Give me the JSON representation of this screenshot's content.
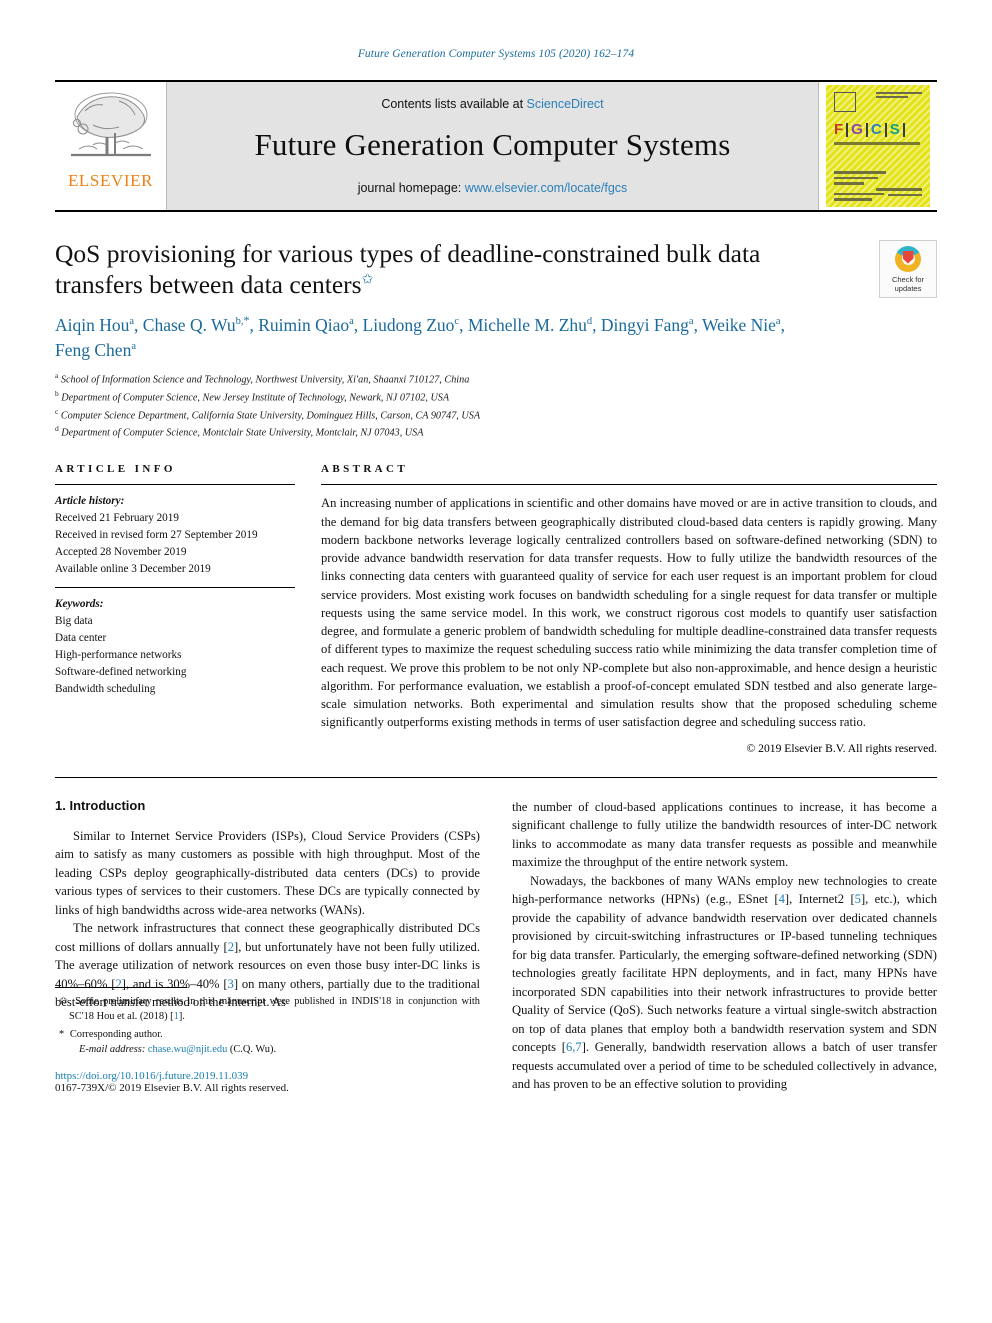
{
  "running_head": "Future Generation Computer Systems 105 (2020) 162–174",
  "masthead": {
    "contents_prefix": "Contents lists available at ",
    "contents_link": "ScienceDirect",
    "journal_title": "Future Generation Computer Systems",
    "homepage_prefix": "journal homepage: ",
    "homepage_link": "www.elsevier.com/locate/fgcs",
    "publisher_name": "ELSEVIER",
    "cover_letters": [
      "F",
      "G",
      "C",
      "S"
    ],
    "cover_letter_colors": [
      "#c0392b",
      "#8e44ad",
      "#2980b9",
      "#16a085"
    ],
    "link_color": "#2a7fb8"
  },
  "article": {
    "title": "QoS provisioning for various types of deadline-constrained bulk data transfers between data centers",
    "title_footnote_marker": "✩",
    "crossmark_label_line1": "Check for",
    "crossmark_label_line2": "updates",
    "authors_html": "Aiqin Hou<sup>a</sup>, Chase Q. Wu<sup>b,<span class=\"star\">*</span></sup>, Ruimin Qiao<sup>a</sup>, Liudong Zuo<sup>c</sup>, Michelle M. Zhu<sup>d</sup>, Dingyi Fang<sup>a</sup>, Weike Nie<sup>a</sup>, Feng Chen<sup>a</sup>",
    "affiliations": [
      {
        "marker": "a",
        "text": "School of Information Science and Technology, Northwest University, Xi'an, Shaanxi 710127, China"
      },
      {
        "marker": "b",
        "text": "Department of Computer Science, New Jersey Institute of Technology, Newark, NJ 07102, USA"
      },
      {
        "marker": "c",
        "text": "Computer Science Department, California State University, Dominguez Hills, Carson, CA 90747, USA"
      },
      {
        "marker": "d",
        "text": "Department of Computer Science, Montclair State University, Montclair, NJ 07043, USA"
      }
    ]
  },
  "article_info": {
    "label": "ARTICLE INFO",
    "history_label": "Article history:",
    "history": [
      "Received 21 February 2019",
      "Received in revised form 27 September 2019",
      "Accepted 28 November 2019",
      "Available online 3 December 2019"
    ],
    "keywords_label": "Keywords:",
    "keywords": [
      "Big data",
      "Data center",
      "High-performance networks",
      "Software-defined networking",
      "Bandwidth scheduling"
    ]
  },
  "abstract": {
    "label": "ABSTRACT",
    "text": "An increasing number of applications in scientific and other domains have moved or are in active transition to clouds, and the demand for big data transfers between geographically distributed cloud-based data centers is rapidly growing. Many modern backbone networks leverage logically centralized controllers based on software-defined networking (SDN) to provide advance bandwidth reservation for data transfer requests. How to fully utilize the bandwidth resources of the links connecting data centers with guaranteed quality of service for each user request is an important problem for cloud service providers. Most existing work focuses on bandwidth scheduling for a single request for data transfer or multiple requests using the same service model. In this work, we construct rigorous cost models to quantify user satisfaction degree, and formulate a generic problem of bandwidth scheduling for multiple deadline-constrained data transfer requests of different types to maximize the request scheduling success ratio while minimizing the data transfer completion time of each request. We prove this problem to be not only NP-complete but also non-approximable, and hence design a heuristic algorithm. For performance evaluation, we establish a proof-of-concept emulated SDN testbed and also generate large-scale simulation networks. Both experimental and simulation results show that the proposed scheduling scheme significantly outperforms existing methods in terms of user satisfaction degree and scheduling success ratio.",
    "copyright": "© 2019 Elsevier B.V. All rights reserved."
  },
  "introduction": {
    "heading": "1. Introduction",
    "left_paragraphs": [
      "Similar to Internet Service Providers (ISPs), Cloud Service Providers (CSPs) aim to satisfy as many customers as possible with high throughput. Most of the leading CSPs deploy geographically-distributed data centers (DCs) to provide various types of services to their customers. These DCs are typically connected by links of high bandwidths across wide-area networks (WANs)."
    ],
    "left_para2_parts": [
      "The network infrastructures that connect these geographically distributed DCs cost millions of dollars annually [",
      "2",
      "], but unfortunately have not been fully utilized. The average utilization of network resources on even those busy inter-DC links is 40%–60% [",
      "2",
      "], and is 30%–40% [",
      "3",
      "] on many others, partially due to the traditional best-effort transfer method on the Internet. As"
    ],
    "right_para1": "the number of cloud-based applications continues to increase, it has become a significant challenge to fully utilize the bandwidth resources of inter-DC network links to accommodate as many data transfer requests as possible and meanwhile maximize the throughput of the entire network system.",
    "right_para2_parts": [
      "Nowadays, the backbones of many WANs employ new technologies to create high-performance networks (HPNs) (e.g., ESnet [",
      "4",
      "], Internet2 [",
      "5",
      "], etc.), which provide the capability of advance bandwidth reservation over dedicated channels provisioned by circuit-switching infrastructures or IP-based tunneling techniques for big data transfer. Particularly, the emerging software-defined networking (SDN) technologies greatly facilitate HPN deployments, and in fact, many HPNs have incorporated SDN capabilities into their network infrastructures to provide better Quality of Service (QoS). Such networks feature a virtual single-switch abstraction on top of data planes that employ both a bandwidth reservation system and SDN concepts [",
      "6,7",
      "]. Generally, bandwidth reservation allows a batch of user transfer requests accumulated over a period of time to be scheduled collectively in advance, and has proven to be an effective solution to providing"
    ]
  },
  "footnotes": {
    "star_marker": "✩",
    "star_parts": [
      "Some preliminary results in this manuscript were published in INDIS'18 in conjunction with SC'18 Hou et al. (2018) [",
      "1",
      "]."
    ],
    "corresponding_marker": "*",
    "corresponding_text": "Corresponding author.",
    "email_label": "E-mail address:",
    "email": "chase.wu@njit.edu",
    "email_suffix": "(C.Q. Wu).",
    "doi": "https://doi.org/10.1016/j.future.2019.11.039",
    "issn": "0167-739X/© 2019 Elsevier B.V. All rights reserved."
  }
}
